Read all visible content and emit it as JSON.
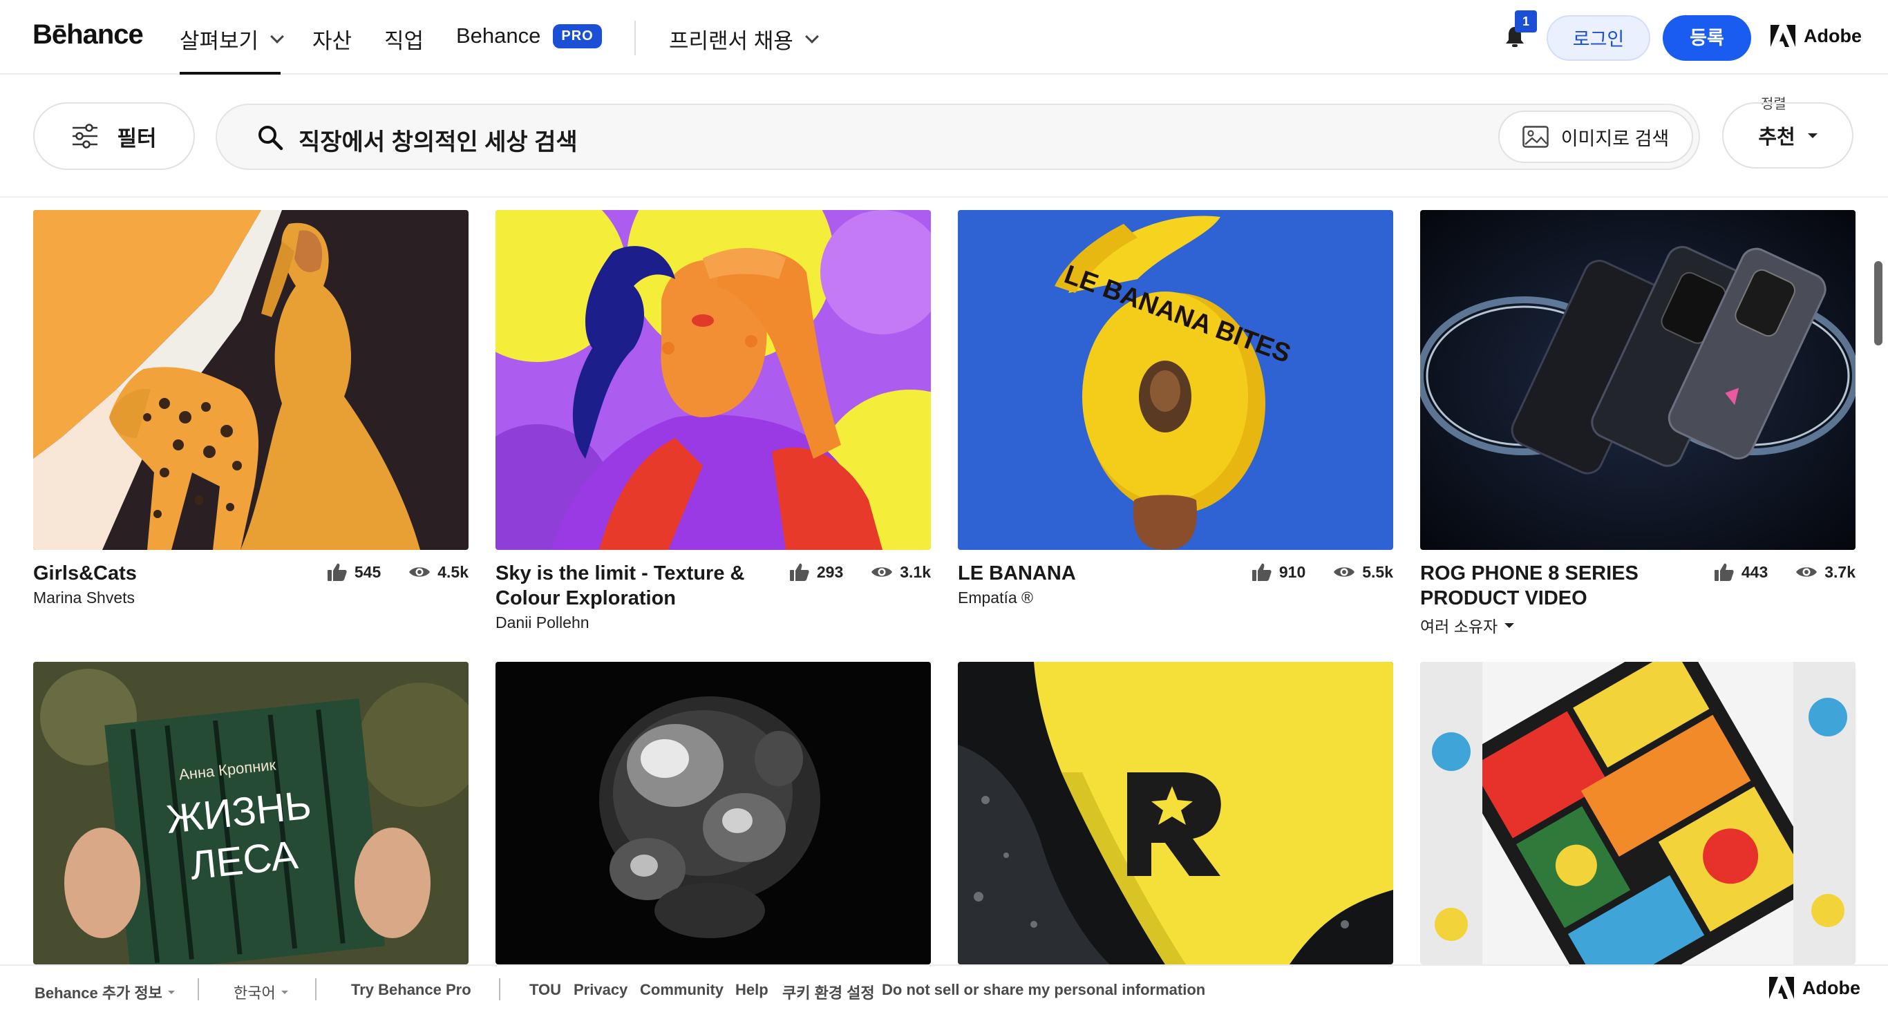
{
  "nav": {
    "logo": "Bēhance",
    "explore": "살펴보기",
    "assets": "자산",
    "jobs": "직업",
    "behance_pro": "Behance",
    "pro_badge": "PRO",
    "hire": "프리랜서 채용",
    "notifications_count": "1",
    "login": "로그인",
    "signup": "등록",
    "adobe": "Adobe"
  },
  "search": {
    "filter_label": "필터",
    "query": "직장에서 창의적인 세상 검색",
    "image_search_label": "이미지로 검색",
    "sort_caption": "정렬",
    "sort_value": "추천"
  },
  "projects": [
    {
      "title": "Girls&Cats",
      "owner": "Marina Shvets",
      "likes": "545",
      "views": "4.5k"
    },
    {
      "title": "Sky is the limit - Texture & Colour Exploration",
      "owner": "Danii Pollehn",
      "likes": "293",
      "views": "3.1k"
    },
    {
      "title": "LE BANANA",
      "owner": "Empatía ®",
      "likes": "910",
      "views": "5.5k"
    },
    {
      "title": "ROG PHONE 8 SERIES PRODUCT VIDEO",
      "owner": "여러 소유자",
      "likes": "443",
      "views": "3.7k"
    }
  ],
  "thumbs_row2": {
    "book_author": "Анна Кропник",
    "book_title_1": "ЖИЗНЬ",
    "book_title_2": "ЛЕСА"
  },
  "banana_label": "LE BANANA BITES",
  "footer": {
    "more_info": "Behance 추가 정보",
    "language": "한국어",
    "try_pro": "Try Behance Pro",
    "tou": "TOU",
    "privacy": "Privacy",
    "community": "Community",
    "help": "Help",
    "cookie": "쿠키 환경 설정",
    "do_not_sell": "Do not sell or share my personal information",
    "adobe": "Adobe"
  }
}
